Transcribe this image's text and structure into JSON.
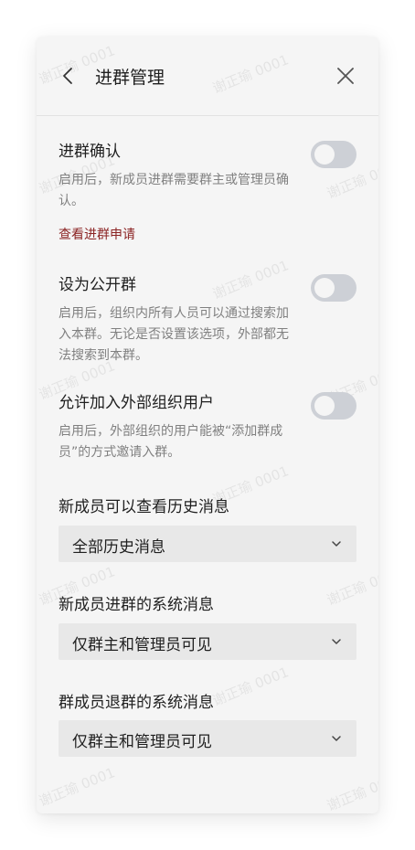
{
  "header": {
    "title": "进群管理"
  },
  "join_confirm": {
    "title": "进群确认",
    "desc": "启用后，新成员进群需要群主或管理员确认。",
    "link": "查看进群申请",
    "enabled": false
  },
  "public_group": {
    "title": "设为公开群",
    "desc": "启用后，组织内所有人员可以通过搜索加入本群。无论是否设置该选项，外部都无法搜索到本群。",
    "enabled": false
  },
  "external_users": {
    "title": "允许加入外部组织用户",
    "desc": "启用后，外部组织的用户能被“添加群成员”的方式邀请入群。",
    "enabled": false
  },
  "history": {
    "label": "新成员可以查看历史消息",
    "value": "全部历史消息"
  },
  "join_message": {
    "label": "新成员进群的系统消息",
    "value": "仅群主和管理员可见"
  },
  "leave_message": {
    "label": "群成员退群的系统消息",
    "value": "仅群主和管理员可见"
  },
  "watermark": "谢正瑜 0001",
  "colors": {
    "link": "#8b2323",
    "toggle_off": "#cdd0d6",
    "select_bg": "#e8e8e8"
  }
}
